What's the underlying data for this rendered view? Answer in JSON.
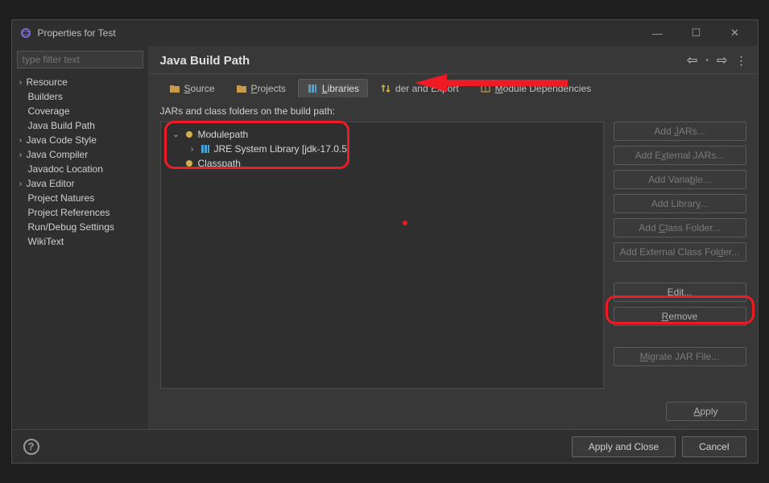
{
  "window": {
    "title": "Properties for Test"
  },
  "filter_placeholder": "type filter text",
  "sidebar": {
    "nodes": [
      {
        "label": "Resource",
        "expandable": true,
        "expanded": false
      },
      {
        "label": "Builders",
        "expandable": false
      },
      {
        "label": "Coverage",
        "expandable": false
      },
      {
        "label": "Java Build Path",
        "expandable": false
      },
      {
        "label": "Java Code Style",
        "expandable": true,
        "expanded": false
      },
      {
        "label": "Java Compiler",
        "expandable": true,
        "expanded": false
      },
      {
        "label": "Javadoc Location",
        "expandable": false
      },
      {
        "label": "Java Editor",
        "expandable": true,
        "expanded": false
      },
      {
        "label": "Project Natures",
        "expandable": false
      },
      {
        "label": "Project References",
        "expandable": false
      },
      {
        "label": "Run/Debug Settings",
        "expandable": false
      },
      {
        "label": "WikiText",
        "expandable": false
      }
    ]
  },
  "header": {
    "title": "Java Build Path"
  },
  "tabs": [
    {
      "label": "Source",
      "ukey": "S"
    },
    {
      "label": "Projects",
      "ukey": "P"
    },
    {
      "label": "Libraries",
      "ukey": "L",
      "active": true
    },
    {
      "label": "Order and Export",
      "ukey": "O",
      "display": "der and Export"
    },
    {
      "label": "Module Dependencies",
      "ukey": "M",
      "display": "Module Dependencies"
    }
  ],
  "subheading": "JARs and class folders on the build path:",
  "libtree": {
    "modulepath_label": "Modulepath",
    "jre_label": "JRE System Library [jdk-17.0.5]",
    "classpath_label": "Classpath"
  },
  "buttons": {
    "add_jars": "Add JARs...",
    "add_ext_jars": "Add External JARs...",
    "add_variable": "Add Variable...",
    "add_library": "Add Library...",
    "add_class_folder": "Add Class Folder...",
    "add_ext_class_folder": "Add External Class Folder...",
    "edit": "Edit...",
    "remove": "Remove",
    "migrate": "Migrate JAR File...",
    "apply": "Apply"
  },
  "footer": {
    "apply_close": "Apply and Close",
    "cancel": "Cancel"
  }
}
